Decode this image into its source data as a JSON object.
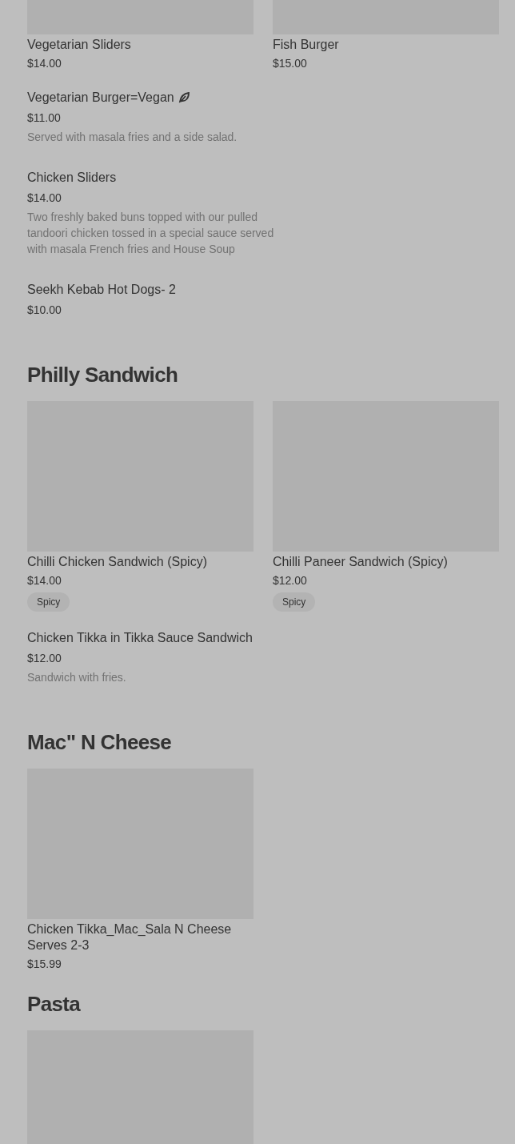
{
  "sections": [
    {
      "items": [
        {
          "kind": "card",
          "name": "Vegetarian Sliders",
          "price": "$14.00"
        },
        {
          "kind": "card",
          "name": "Fish Burger",
          "price": "$15.00"
        },
        {
          "kind": "row",
          "name": "Vegetarian Burger=Vegan",
          "vegan": true,
          "price": "$11.00",
          "description": "Served with masala fries and a side salad."
        },
        {
          "kind": "row",
          "name": "Chicken Sliders",
          "price": "$14.00",
          "description": "Two freshly baked buns topped with our pulled tandoori chicken tossed in a special sauce served with masala French fries and House Soup"
        },
        {
          "kind": "row",
          "name": "Seekh Kebab Hot Dogs- 2",
          "price": "$10.00"
        }
      ]
    },
    {
      "title": "Philly Sandwich",
      "items": [
        {
          "kind": "card",
          "name": "Chilli Chicken Sandwich (Spicy)",
          "price": "$14.00",
          "tags": [
            "Spicy"
          ]
        },
        {
          "kind": "card",
          "name": "Chilli Paneer Sandwich (Spicy)",
          "price": "$12.00",
          "tags": [
            "Spicy"
          ]
        },
        {
          "kind": "row",
          "name": "Chicken Tikka in Tikka Sauce Sandwich",
          "price": "$12.00",
          "description": "Sandwich with fries."
        }
      ]
    },
    {
      "title": "Mac\" N Cheese",
      "items": [
        {
          "kind": "card",
          "name": "Chicken Tikka_Mac_Sala N Cheese Serves 2-3",
          "price": "$15.99"
        }
      ]
    },
    {
      "title": "Pasta",
      "items": [
        {
          "kind": "card"
        }
      ]
    }
  ]
}
